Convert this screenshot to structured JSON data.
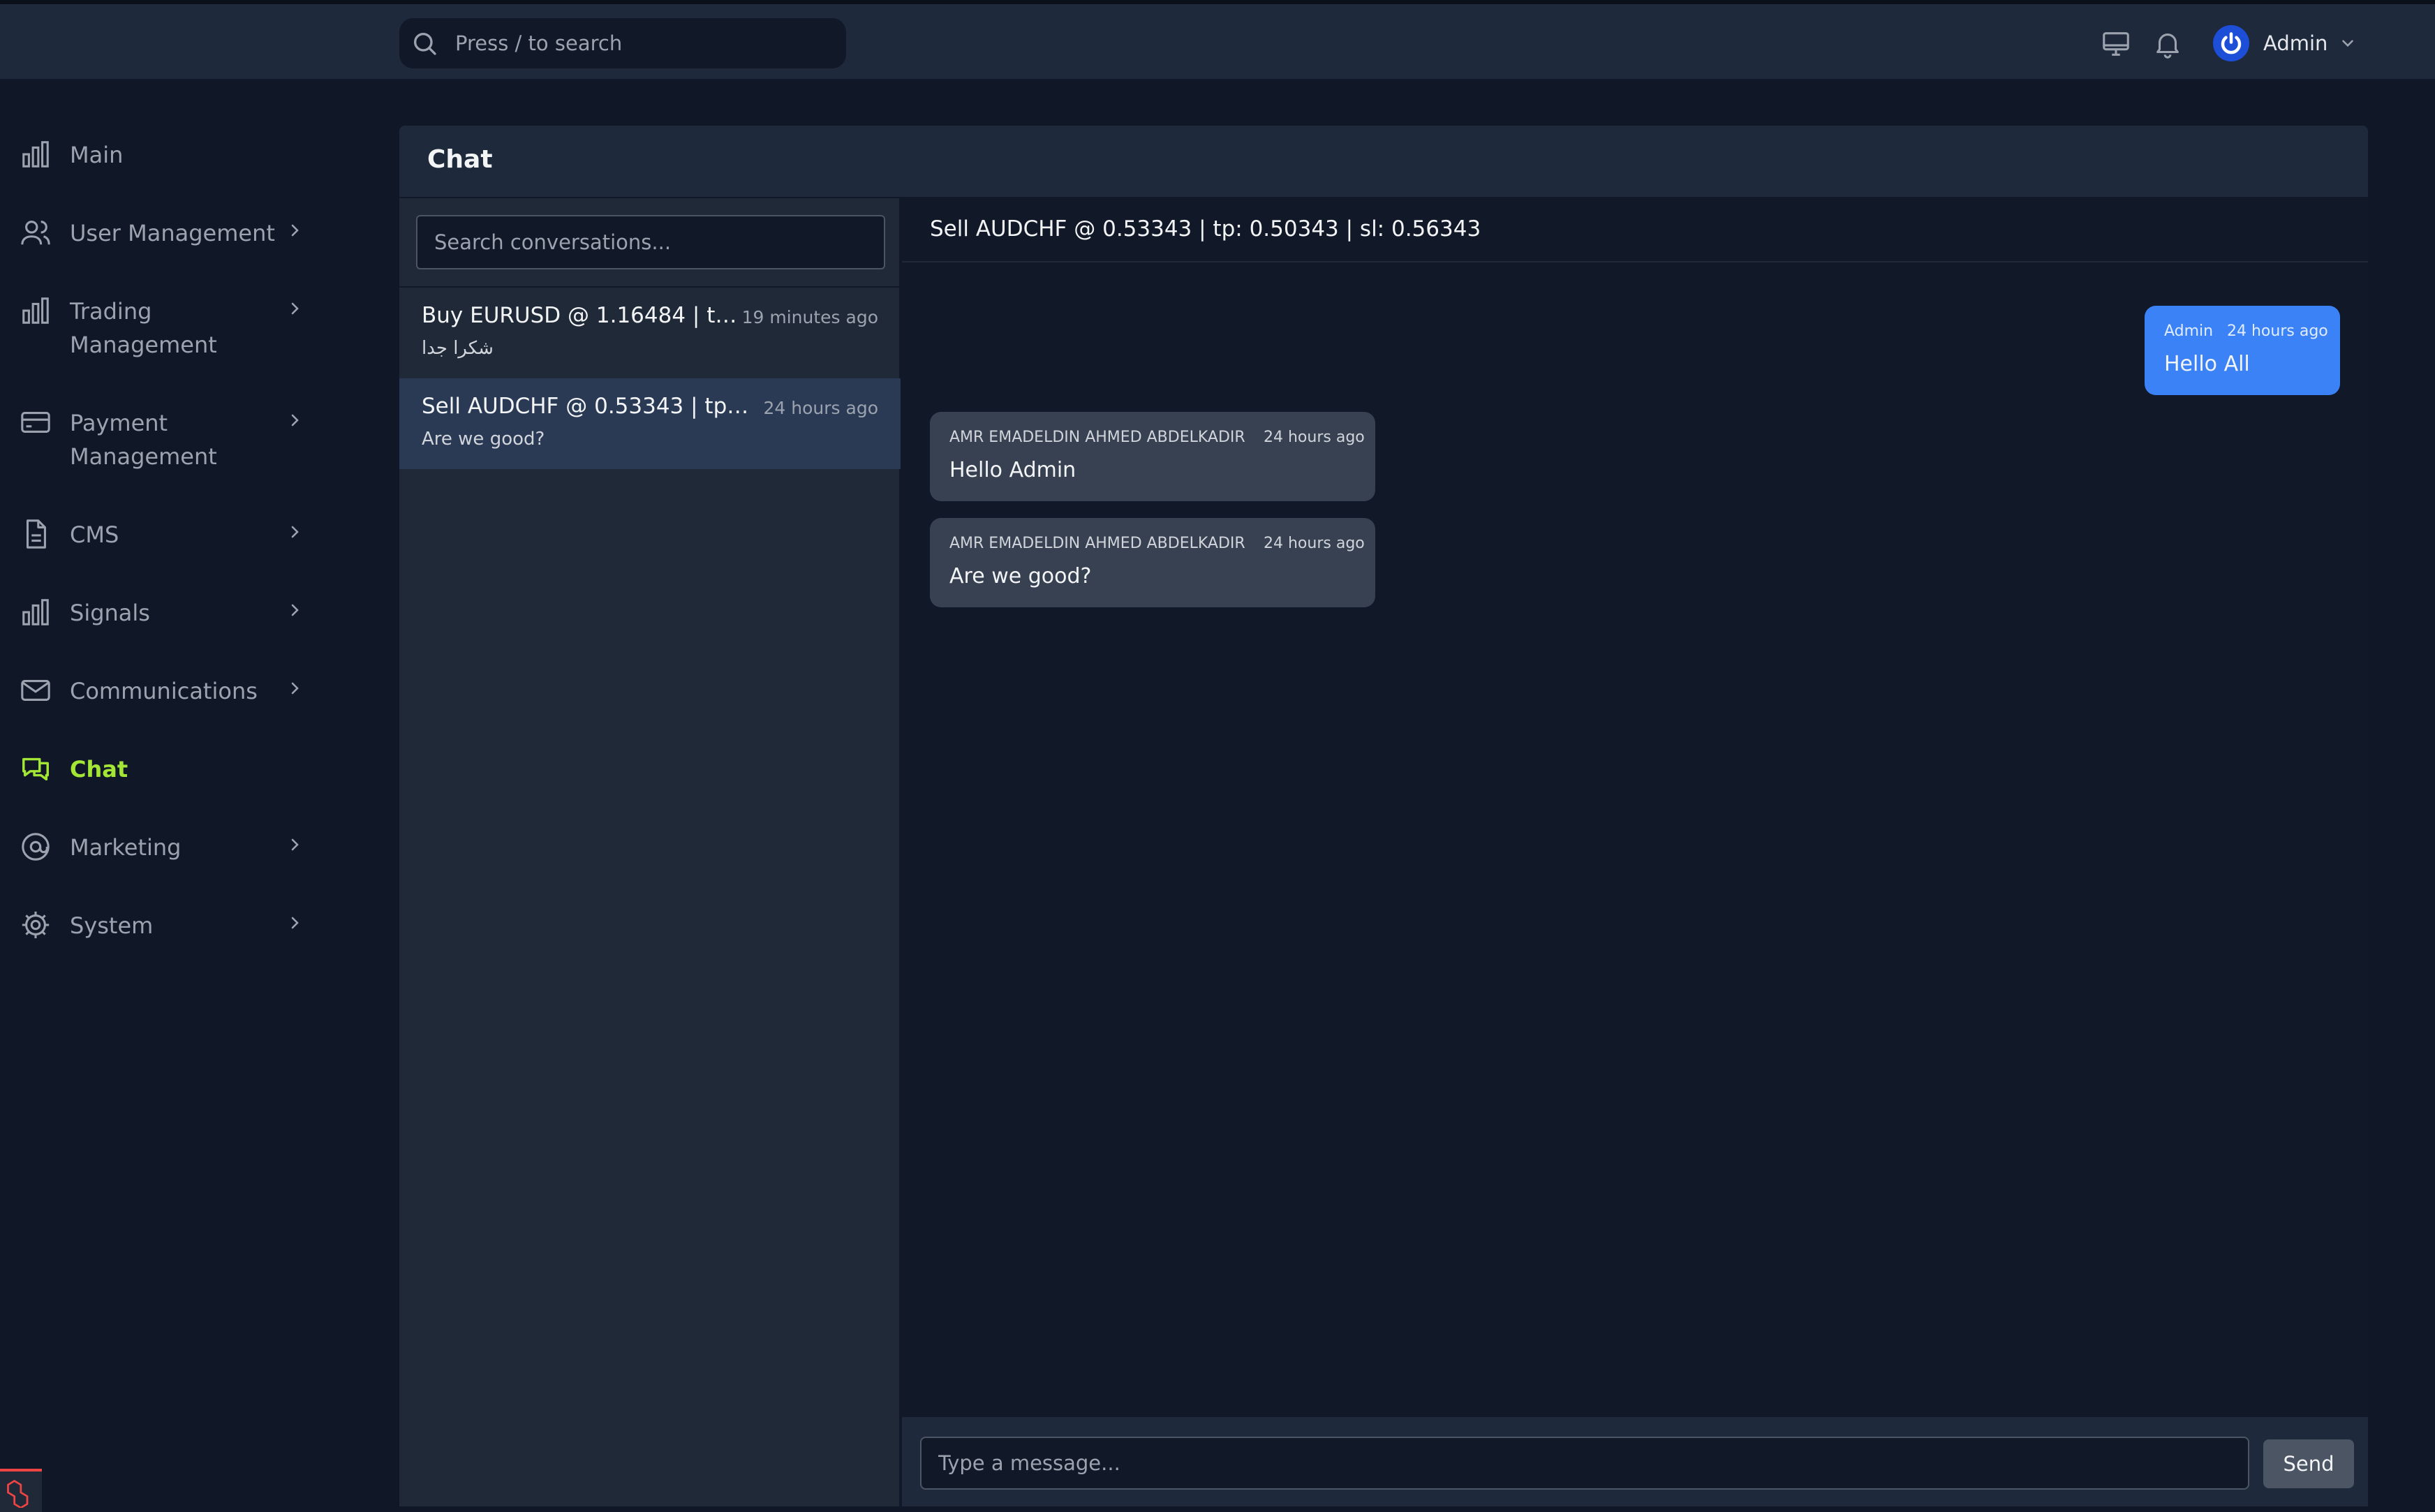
{
  "header": {
    "search_placeholder": "Press / to search",
    "user_name": "Admin",
    "icons": [
      "search-icon",
      "monitor-icon",
      "bell-icon",
      "power-icon",
      "chevron-down-icon"
    ]
  },
  "sidebar": {
    "items": [
      {
        "label": "Main",
        "icon": "bar-chart-icon",
        "has_submenu": false
      },
      {
        "label": "User Management",
        "icon": "users-icon",
        "has_submenu": true
      },
      {
        "label": "Trading Management",
        "icon": "bar-chart-icon",
        "has_submenu": true
      },
      {
        "label": "Payment Management",
        "icon": "credit-card-icon",
        "has_submenu": true
      },
      {
        "label": "CMS",
        "icon": "document-icon",
        "has_submenu": true
      },
      {
        "label": "Signals",
        "icon": "bar-chart-icon",
        "has_submenu": true
      },
      {
        "label": "Communications",
        "icon": "mail-icon",
        "has_submenu": true
      },
      {
        "label": "Chat",
        "icon": "chat-icon",
        "has_submenu": false,
        "active": true
      },
      {
        "label": "Marketing",
        "icon": "at-sign-icon",
        "has_submenu": true
      },
      {
        "label": "System",
        "icon": "gear-icon",
        "has_submenu": true
      }
    ]
  },
  "chat": {
    "title": "Chat",
    "search_placeholder": "Search conversations...",
    "conversations": [
      {
        "title": "Buy EURUSD @ 1.16484 | tp: 1....",
        "time": "19 minutes ago",
        "preview": "شكرا جدا",
        "selected": false
      },
      {
        "title": "Sell AUDCHF @ 0.53343 | tp: 0.5...",
        "time": "24 hours ago",
        "preview": "Are we good?",
        "selected": true
      }
    ],
    "thread": {
      "title": "Sell AUDCHF @ 0.53343 | tp: 0.50343 | sl: 0.56343",
      "messages": [
        {
          "sender": "Admin",
          "time": "24 hours ago",
          "text": "Hello All",
          "direction": "outgoing"
        },
        {
          "sender": "AMR EMADELDIN AHMED ABDELKADIR",
          "time": "24 hours ago",
          "text": "Hello Admin",
          "direction": "incoming"
        },
        {
          "sender": "AMR EMADELDIN AHMED ABDELKADIR",
          "time": "24 hours ago",
          "text": "Are we good?",
          "direction": "incoming"
        }
      ]
    },
    "composer": {
      "placeholder": "Type a message...",
      "send_label": "Send"
    }
  },
  "colors": {
    "background": "#101828",
    "active_nav": "#a3e635",
    "outgoing_bubble": "#3b82f6",
    "incoming_bubble": "#374151",
    "selected_conversation": "#2a3a55"
  }
}
